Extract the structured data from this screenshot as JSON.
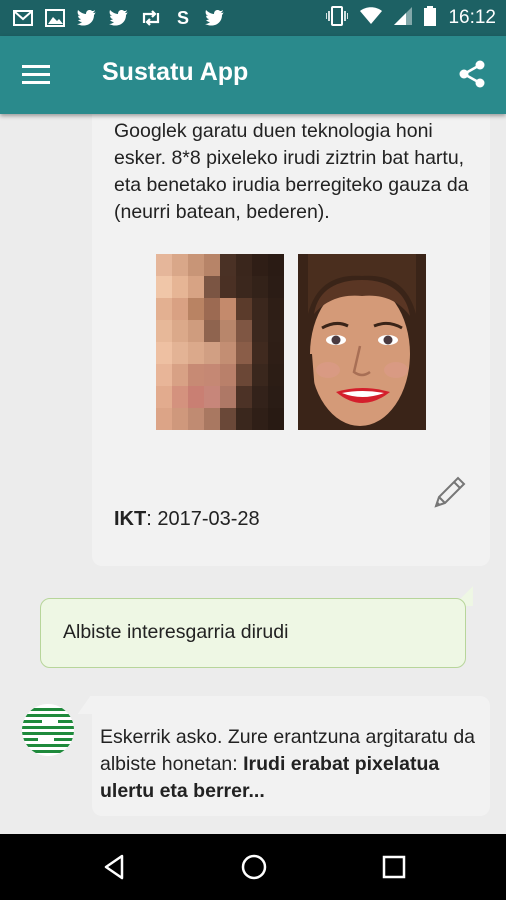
{
  "status_bar": {
    "time": "16:12",
    "left_icons": [
      "gmail-icon",
      "image-icon",
      "twitter-icon",
      "twitter-icon",
      "retweet-icon",
      "s-icon",
      "twitter-icon"
    ],
    "s_glyph": "S",
    "right_icons": [
      "vibrate-icon",
      "wifi-icon",
      "signal-icon",
      "battery-icon"
    ]
  },
  "app_bar": {
    "title": "Sustatu App",
    "color": "#2a8a8c"
  },
  "article_card": {
    "text": "Googlek garatu duen teknologia honi esker. 8*8 pixeleko irudi ziztrin bat hartu, eta benetako irudia berregiteko gauza da (neurri batean, bederen).",
    "source_label": "IKT",
    "source_separator": ": ",
    "date": "2017-03-28"
  },
  "user_comment": {
    "text": "Albiste interesgarria dirudi"
  },
  "reply": {
    "text_plain": "Eskerrik asko. Zure erantzuna argitaratu da albiste honetan: ",
    "text_bold": "Irudi erabat pixelatua ulertu eta berrer..."
  },
  "nav_bar": {
    "buttons": [
      "back-icon",
      "home-icon",
      "recents-icon"
    ]
  },
  "colors": {
    "status_bar": "#1d6164",
    "accent": "#2a8a8c",
    "bubble_out": "#eef7e4",
    "avatar_green": "#1f8a3c"
  }
}
